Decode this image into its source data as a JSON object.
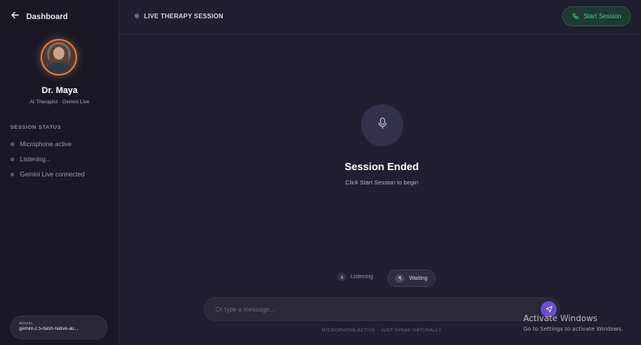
{
  "sidebar": {
    "back_label": "Dashboard",
    "doctor_name": "Dr. Maya",
    "doctor_role": "AI Therapist · Gemini Live",
    "status_title": "SESSION STATUS",
    "status_items": [
      {
        "label": "Microphone active"
      },
      {
        "label": "Listening..."
      },
      {
        "label": "Gemini Live connected"
      }
    ],
    "model": {
      "label": "MODEL",
      "value": "gemini-2.5-flash-native-au..."
    }
  },
  "header": {
    "title": "LIVE THERAPY SESSION",
    "start_label": "Start Session"
  },
  "main": {
    "state_title": "Session Ended",
    "state_subtitle": "Click Start Session to begin",
    "listening_label": "Listening",
    "waiting_label": "Waiting",
    "message_placeholder": "Or type a message...",
    "footer_note": "MICROPHONE ACTIVE · JUST SPEAK NATURALLY"
  },
  "watermark": {
    "title": "Activate Windows",
    "subtitle": "Go to Settings to activate Windows."
  },
  "colors": {
    "accent_green": "#3fd28b",
    "accent_purple": "#6a4fc8",
    "avatar_ring": "#e07a3a"
  }
}
